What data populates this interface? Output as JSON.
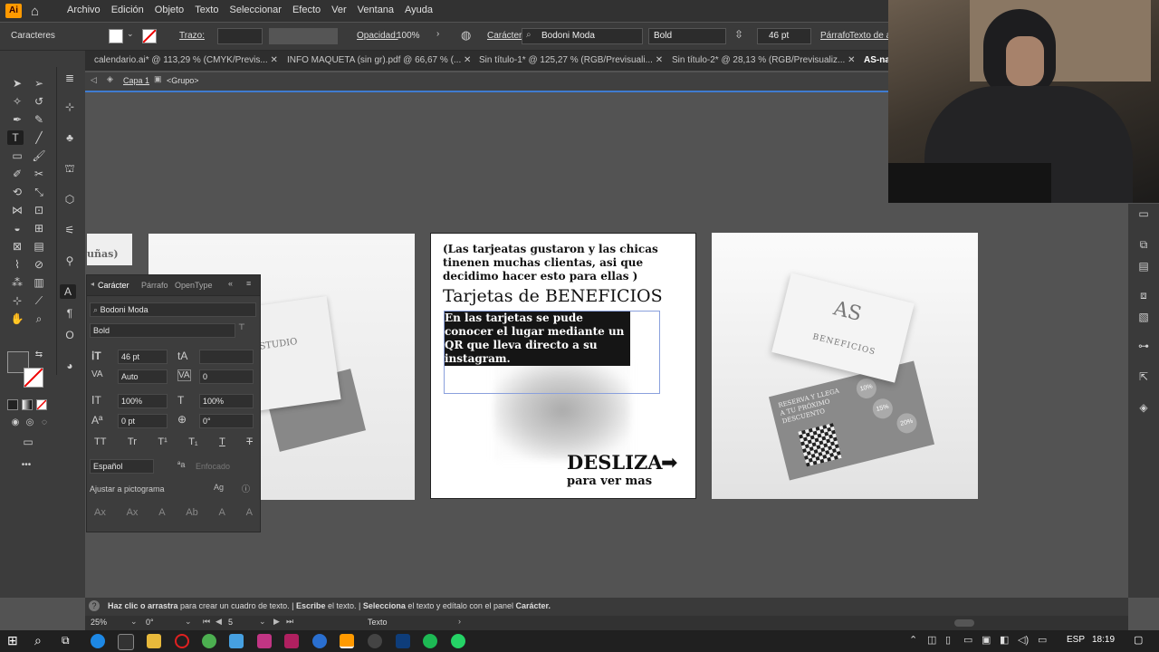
{
  "app": {
    "logo_text": "Ai",
    "accent": "#ff9a00"
  },
  "menu": [
    "Archivo",
    "Edición",
    "Objeto",
    "Texto",
    "Seleccionar",
    "Efecto",
    "Ver",
    "Ventana",
    "Ayuda"
  ],
  "control_bar": {
    "panel_label": "Caracteres",
    "stroke_label": "Trazo:",
    "opacity_label": "Opacidad:",
    "opacity_value": "100%",
    "character_label": "Carácter:",
    "font_family": "Bodoni Moda",
    "font_style": "Bold",
    "font_size": "46 pt",
    "paragraph_label": "Párrafo",
    "text_area_label": "Texto de ár"
  },
  "tabs": [
    "calendario.ai* @ 113,29 % (CMYK/Previs...",
    "INFO MAQUETA (sin gr).pdf @ 66,67 % (...",
    "Sin título-1* @ 125,27 % (RGB/Previsuali...",
    "Sin título-2* @ 28,13 % (RGB/Previsualiz...",
    "AS-na"
  ],
  "breadcrumb": {
    "layer": "Capa 1",
    "group": "<Grupo>"
  },
  "artboards": {
    "left_partial_text": "uñas)",
    "left_card_text": "STUDIO",
    "center": {
      "intro": "(Las tarjeatas gustaron y las chicas tinenen muchas clientas, asi que decidimo hacer esto para ellas )",
      "title": "Tarjetas de BENEFICIOS",
      "body": "En las tarjetas se pude conocer el lugar mediante un QR que lleva directo a su instagram.",
      "cta": "DESLIZA",
      "cta_arrow": "➡",
      "cta_sub": "para ver mas"
    },
    "right": {
      "card_logo": "AS",
      "card_title": "BENEFICIOS",
      "stamp_text": "RESERVA Y LLEGA A TU PRÓXIMO DESCUENTO",
      "badge_10": "10%",
      "badge_15": "15%",
      "badge_20": "20%"
    }
  },
  "char_panel": {
    "tabs": [
      "Carácter",
      "Párrafo",
      "OpenType"
    ],
    "font_family": "Bodoni Moda",
    "font_style": "Bold",
    "size": "46 pt",
    "leading": "",
    "kerning": "Auto",
    "tracking": "0",
    "vscale": "100%",
    "hscale": "100%",
    "baseline": "0 pt",
    "rotation": "0°",
    "caps_buttons": [
      "TT",
      "Tr",
      "T¹",
      "T₁",
      "T",
      "T"
    ],
    "language": "Español",
    "antialias": "Enfocado",
    "snap_label": "Ajustar a pictograma",
    "glyph_buttons": [
      "Ax",
      "Ax",
      "A",
      "Ab",
      "A",
      "A"
    ]
  },
  "status": {
    "hint_1": "Haz clic o arrastra",
    "hint_2": " para crear un cuadro de texto. | ",
    "hint_3": "Escribe",
    "hint_4": " el texto. | ",
    "hint_5": "Selecciona",
    "hint_6": " el texto y edítalo con el panel ",
    "hint_7": "Carácter."
  },
  "bottom_bar": {
    "zoom": "25%",
    "rotation": "0°",
    "artboard": "5",
    "mode": "Texto"
  },
  "taskbar": {
    "lang": "ESP",
    "time": "18:19"
  }
}
